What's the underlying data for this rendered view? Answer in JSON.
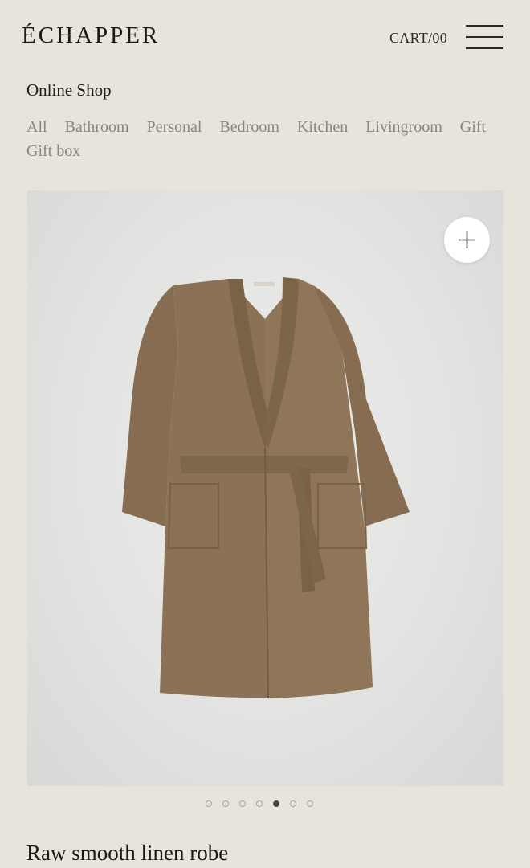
{
  "header": {
    "logo": "ÉCHAPPER",
    "cart_label": "CART/00"
  },
  "shop": {
    "title": "Online Shop",
    "categories": [
      "All",
      "Bathroom",
      "Personal",
      "Bedroom",
      "Kitchen",
      "Livingroom",
      "Gift",
      "Gift box"
    ]
  },
  "gallery": {
    "image_alt": "robe-photo",
    "slide_count": 7,
    "active_slide": 5,
    "zoom_icon": "plus-icon"
  },
  "product": {
    "title": "Raw smooth linen robe"
  },
  "colors": {
    "background": "#e8e4dc",
    "robe": "#8b7256",
    "category_text": "#8a857d"
  }
}
